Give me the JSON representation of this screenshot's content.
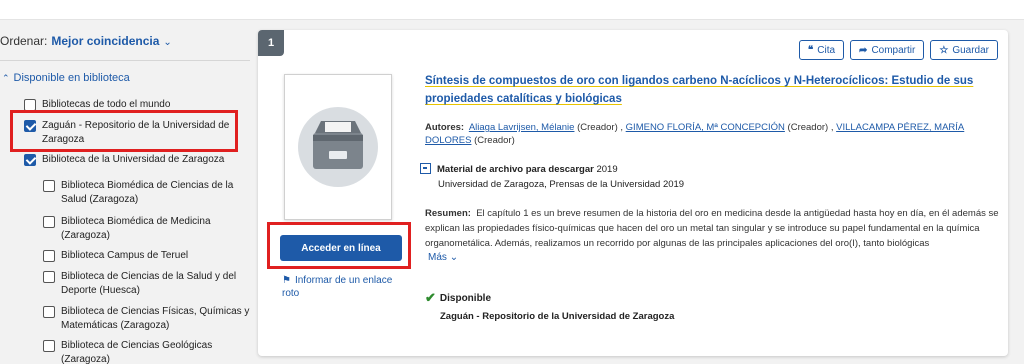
{
  "sort": {
    "label": "Ordenar:",
    "value": "Mejor coincidencia"
  },
  "facet": {
    "title": "Disponible en biblioteca",
    "items": [
      {
        "label": "Bibliotecas de todo el mundo",
        "checked": false
      },
      {
        "label": "Zaguán - Repositorio de la Universidad de Zaragoza",
        "checked": true
      },
      {
        "label": "Biblioteca de la Universidad de Zaragoza",
        "checked": true
      },
      {
        "label": "Biblioteca Biomédica de Ciencias de la Salud (Zaragoza)",
        "checked": false
      },
      {
        "label": "Biblioteca Biomédica de Medicina (Zaragoza)",
        "checked": false
      },
      {
        "label": "Biblioteca Campus de Teruel",
        "checked": false
      },
      {
        "label": "Biblioteca de Ciencias de la Salud y del Deporte (Huesca)",
        "checked": false
      },
      {
        "label": "Biblioteca de Ciencias Físicas, Químicas y Matemáticas (Zaragoza)",
        "checked": false
      },
      {
        "label": "Biblioteca de Ciencias Geológicas (Zaragoza)",
        "checked": false
      }
    ]
  },
  "result": {
    "number": "1",
    "actions": {
      "cite": "Cita",
      "share": "Compartir",
      "save": "Guardar"
    },
    "access_button": "Acceder en línea",
    "report_link": "Informar de un enlace roto",
    "title": "Síntesis de compuestos de oro con ligandos carbeno N-acíclicos y N-Heterocíclicos: Estudio de sus propiedades catalíticas y biológicas",
    "authors_label": "Autores:",
    "authors": [
      {
        "name": "Aliaga Lavrijsen, Mélanie",
        "role": "(Creador) ,"
      },
      {
        "name": "GIMENO FLORÍA, Mª CONCEPCIÓN",
        "role": "(Creador) ,"
      },
      {
        "name": "VILLACAMPA PÉREZ, MARÍA DOLORES",
        "role": "(Creador)"
      }
    ],
    "format": "Material de archivo para descargar",
    "year": "2019",
    "publisher": "Universidad de Zaragoza, Prensas de la Universidad 2019",
    "abstract_label": "Resumen:",
    "abstract": "El capítulo 1 es un breve resumen de la historia del oro en medicina desde la antigüedad hasta hoy en día, en él además se explican las propiedades físico-químicas que hacen del oro un metal tan singular y se introduce su papel fundamental en la química organometálica. Además, realizamos un recorrido por algunas de las principales aplicaciones del oro(I), tanto biológicas",
    "more": "Más",
    "availability": "Disponible",
    "repository": "Zaguán - Repositorio de la Universidad de Zaragoza"
  },
  "colors": {
    "accent": "#1e5aa8",
    "highlight_box": "#e02020",
    "available": "#2e8b2e",
    "keyword_underline": "#e8c400"
  }
}
